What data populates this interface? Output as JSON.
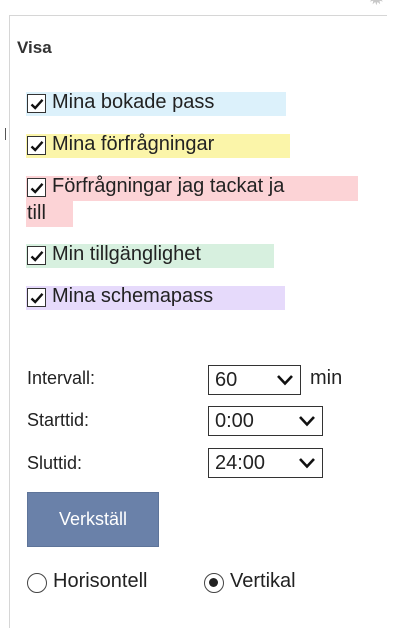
{
  "panel": {
    "heading": "Visa",
    "checkboxes": [
      {
        "label": "Mina bokade pass",
        "checked": true,
        "color": "#dcf1fb"
      },
      {
        "label": "Mina förfrågningar",
        "checked": true,
        "color": "#fbf5a9"
      },
      {
        "label_line1": "Förfrågningar jag tackat ja",
        "label_line2": "till",
        "checked": true,
        "color": "#fcd3d6"
      },
      {
        "label": "Min tillgänglighet",
        "checked": true,
        "color": "#d7f0df"
      },
      {
        "label": "Mina schemapass",
        "checked": true,
        "color": "#e6dafb"
      }
    ],
    "intervall": {
      "label": "Intervall:",
      "value": "60",
      "unit": "min"
    },
    "starttid": {
      "label": "Starttid:",
      "value": "0:00"
    },
    "sluttid": {
      "label": "Sluttid:",
      "value": "24:00"
    },
    "apply_button": "Verkställ",
    "orientation": {
      "options": [
        {
          "label": "Horisontell",
          "selected": false
        },
        {
          "label": "Vertikal",
          "selected": true
        }
      ]
    },
    "icons": {
      "settings": "gear-icon",
      "checkbox_mark": "check-icon",
      "select_arrow": "chevron-down-icon"
    }
  }
}
